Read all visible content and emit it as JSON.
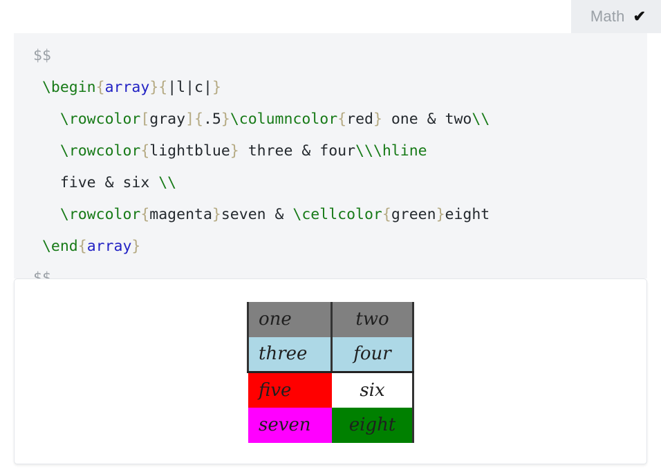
{
  "tab": {
    "label": "Math",
    "check_icon": "✔",
    "active": true
  },
  "editor": {
    "language": "latex",
    "lines": [
      {
        "indent": "",
        "tokens": [
          {
            "t": "delim",
            "s": "$$"
          }
        ]
      },
      {
        "indent": " ",
        "tokens": [
          {
            "t": "cmd",
            "s": "\\begin"
          },
          {
            "t": "brace",
            "s": "{"
          },
          {
            "t": "env",
            "s": "array"
          },
          {
            "t": "brace",
            "s": "}"
          },
          {
            "t": "brace",
            "s": "{"
          },
          {
            "t": "plain",
            "s": "|l|c|"
          },
          {
            "t": "brace",
            "s": "}"
          }
        ]
      },
      {
        "indent": "   ",
        "tokens": [
          {
            "t": "cmd",
            "s": "\\rowcolor"
          },
          {
            "t": "brace",
            "s": "["
          },
          {
            "t": "plain",
            "s": "gray"
          },
          {
            "t": "brace",
            "s": "]"
          },
          {
            "t": "brace",
            "s": "{"
          },
          {
            "t": "plain",
            "s": ".5"
          },
          {
            "t": "brace",
            "s": "}"
          },
          {
            "t": "cmd",
            "s": "\\columncolor"
          },
          {
            "t": "brace",
            "s": "{"
          },
          {
            "t": "plain",
            "s": "red"
          },
          {
            "t": "brace",
            "s": "}"
          },
          {
            "t": "plain",
            "s": " one & two"
          },
          {
            "t": "cmd",
            "s": "\\\\"
          }
        ]
      },
      {
        "indent": "   ",
        "tokens": [
          {
            "t": "cmd",
            "s": "\\rowcolor"
          },
          {
            "t": "brace",
            "s": "{"
          },
          {
            "t": "plain",
            "s": "lightblue"
          },
          {
            "t": "brace",
            "s": "}"
          },
          {
            "t": "plain",
            "s": " three & four"
          },
          {
            "t": "cmd",
            "s": "\\\\\\hline"
          }
        ]
      },
      {
        "indent": "   ",
        "tokens": [
          {
            "t": "plain",
            "s": "five & six "
          },
          {
            "t": "cmd",
            "s": "\\\\"
          }
        ]
      },
      {
        "indent": "   ",
        "tokens": [
          {
            "t": "cmd",
            "s": "\\rowcolor"
          },
          {
            "t": "brace",
            "s": "{"
          },
          {
            "t": "plain",
            "s": "magenta"
          },
          {
            "t": "brace",
            "s": "}"
          },
          {
            "t": "plain",
            "s": "seven & "
          },
          {
            "t": "cmd",
            "s": "\\cellcolor"
          },
          {
            "t": "brace",
            "s": "{"
          },
          {
            "t": "plain",
            "s": "green"
          },
          {
            "t": "brace",
            "s": "}"
          },
          {
            "t": "plain",
            "s": "eight"
          }
        ]
      },
      {
        "indent": " ",
        "tokens": [
          {
            "t": "cmd",
            "s": "\\end"
          },
          {
            "t": "brace",
            "s": "{"
          },
          {
            "t": "env",
            "s": "array"
          },
          {
            "t": "brace",
            "s": "}"
          }
        ]
      },
      {
        "indent": "",
        "tokens": [
          {
            "t": "delim",
            "s": "$$"
          }
        ]
      }
    ],
    "syntax_colors": {
      "delimiter": "#9aa0a6",
      "command": "#177a17",
      "brace": "#b5aa83",
      "environment": "#2323c4",
      "plain": "#24292e",
      "background": "#f4f5f7"
    }
  },
  "output": {
    "array": {
      "column_spec": "|l|c|",
      "rows": [
        {
          "hline_below": false,
          "rules_visible": true,
          "cells": [
            {
              "text": "one",
              "bg": "gray50",
              "align": "l"
            },
            {
              "text": "two",
              "bg": "gray50",
              "align": "c"
            }
          ]
        },
        {
          "hline_below": true,
          "rules_visible": true,
          "cells": [
            {
              "text": "three",
              "bg": "lightblue",
              "align": "l"
            },
            {
              "text": "four",
              "bg": "lightblue",
              "align": "c"
            }
          ]
        },
        {
          "hline_below": false,
          "rules_visible": false,
          "cells": [
            {
              "text": "five",
              "bg": "red",
              "align": "l"
            },
            {
              "text": "six",
              "bg": "white",
              "align": "c"
            }
          ]
        },
        {
          "hline_below": false,
          "rules_visible": false,
          "cells": [
            {
              "text": "seven",
              "bg": "magenta",
              "align": "l"
            },
            {
              "text": "eight",
              "bg": "green",
              "align": "c"
            }
          ]
        }
      ],
      "colors": {
        "gray50": "#808080",
        "lightblue": "#add8e6",
        "red": "#ff0000",
        "white": "#ffffff",
        "magenta": "#ff00ff",
        "green": "#008000",
        "rule": "#333333"
      }
    }
  }
}
